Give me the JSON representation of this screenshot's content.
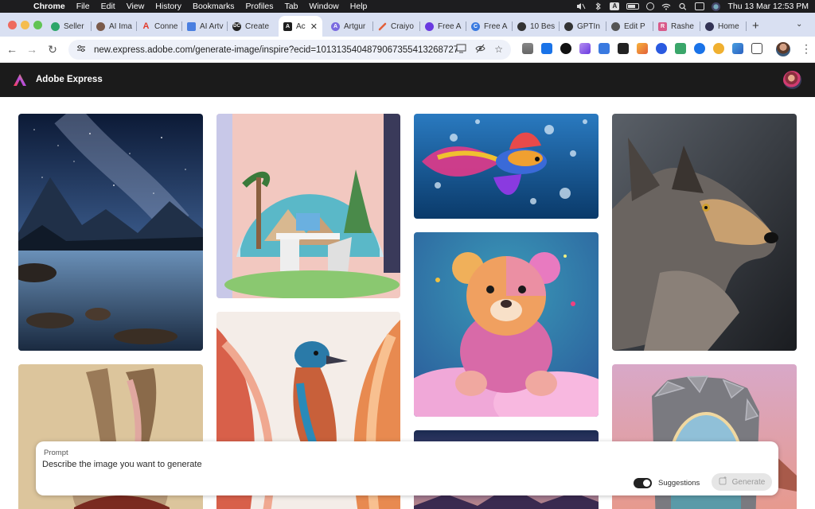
{
  "menubar": {
    "app": "Chrome",
    "items": [
      "File",
      "Edit",
      "View",
      "History",
      "Bookmarks",
      "Profiles",
      "Tab",
      "Window",
      "Help"
    ],
    "clock": "Thu 13 Mar  12:53 PM",
    "input_indicator": "A"
  },
  "tabs": [
    {
      "label": "Seller",
      "fav_color": "#2da66a",
      "fav_glyph": "S"
    },
    {
      "label": "AI Ima",
      "fav_color": "#7a5a4a",
      "fav_glyph": ""
    },
    {
      "label": "Conne",
      "fav_color": "#e23c2c",
      "fav_glyph": "A"
    },
    {
      "label": "AI Artv",
      "fav_color": "#4a7fe0",
      "fav_glyph": ""
    },
    {
      "label": "Create",
      "fav_color": "#222222",
      "fav_glyph": "DC"
    },
    {
      "label": "Ac",
      "fav_color": "#1d1d1d",
      "fav_glyph": "A"
    },
    {
      "label": "Artgur",
      "fav_color": "#7a6ae0",
      "fav_glyph": "A"
    },
    {
      "label": "Craiyo",
      "fav_color": "#e2603a",
      "fav_glyph": ""
    },
    {
      "label": "Free A",
      "fav_color": "#6a3ae0",
      "fav_glyph": ""
    },
    {
      "label": "Free A",
      "fav_color": "#3a7ae0",
      "fav_glyph": "C"
    },
    {
      "label": "10 Bes",
      "fav_color": "#333333",
      "fav_glyph": ""
    },
    {
      "label": "GPTIn",
      "fav_color": "#333333",
      "fav_glyph": ""
    },
    {
      "label": "Edit P",
      "fav_color": "#555555",
      "fav_glyph": ""
    },
    {
      "label": "Rashe",
      "fav_color": "#d85a8a",
      "fav_glyph": "R"
    },
    {
      "label": "Home",
      "fav_color": "#333355",
      "fav_glyph": ""
    }
  ],
  "active_tab_close": "✕",
  "new_tab": "+",
  "toolbar": {
    "url": "new.express.adobe.com/generate-image/inspire?ecid=10131354048790673554132687277921..."
  },
  "app": {
    "name": "Adobe Express"
  },
  "prompt": {
    "label": "Prompt",
    "placeholder": "Describe the image you want to generate",
    "suggestions_label": "Suggestions",
    "suggestions_on": true,
    "generate_label": "Generate"
  },
  "colors": {
    "app_header": "#1b1b1b",
    "tabstrip": "#d9e0f2",
    "generate_disabled": "#e6e6e6"
  },
  "gallery": [
    {
      "subject": "starry-night-mountain-lake"
    },
    {
      "subject": "paper-art-office-desk"
    },
    {
      "subject": "colorful-betta-fish"
    },
    {
      "subject": "gray-wolf-portrait"
    },
    {
      "subject": "rainbow-teddy-bear"
    },
    {
      "subject": "feathered-bird-illustration"
    },
    {
      "subject": "hare-portrait"
    },
    {
      "subject": "mountain-sunset"
    },
    {
      "subject": "broken-mirror-frame"
    }
  ]
}
